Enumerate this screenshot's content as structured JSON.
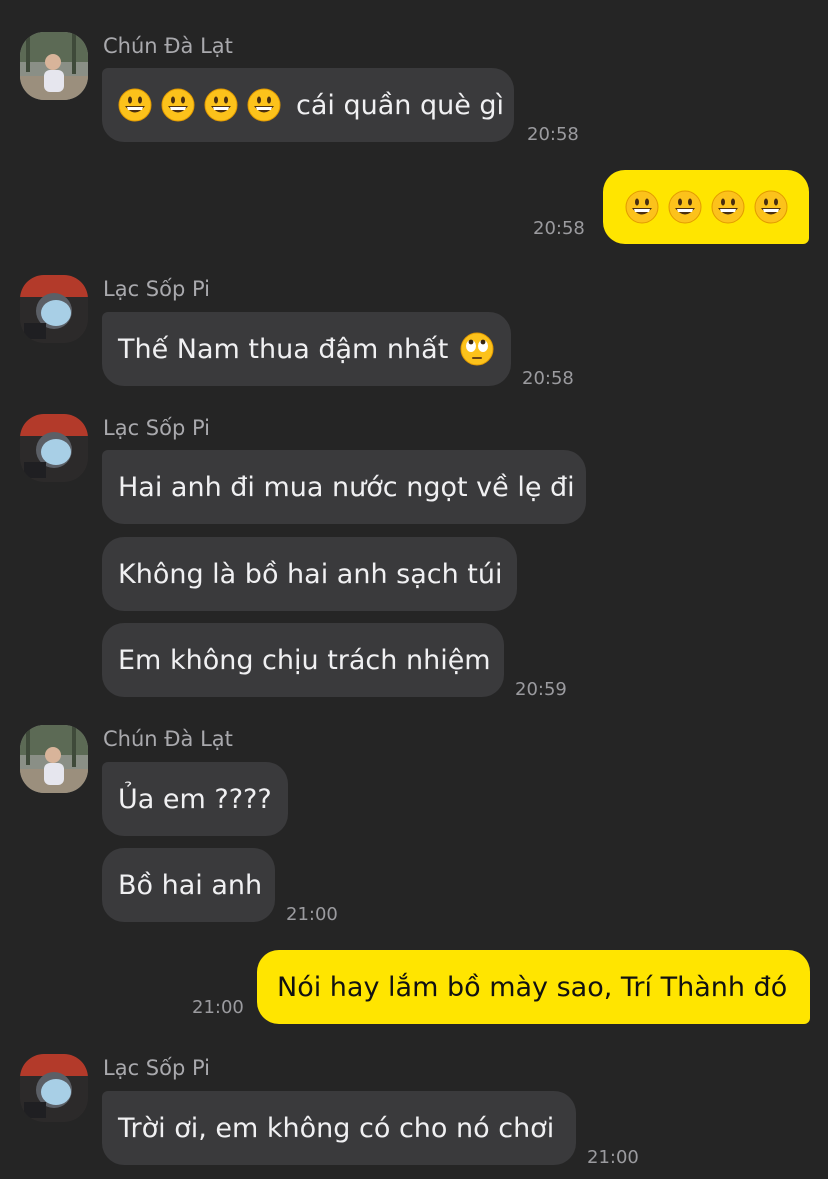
{
  "senders": {
    "chun": "Chún Đà Lạt",
    "lac": "Lạc Sốp Pi"
  },
  "messages": {
    "m1_text": "cái quần què gì",
    "m1_time": "20:58",
    "m2_time": "20:58",
    "m3_text": "Thế Nam thua đậm nhất",
    "m3_time": "20:58",
    "m4_text": "Hai anh đi mua nước ngọt về lẹ đi",
    "m5_text": "Không là bồ hai anh sạch túi",
    "m6_text": "Em không chịu trách nhiệm",
    "m6_time": "20:59",
    "m7_text": "Ủa em ????",
    "m8_text": "Bồ hai anh",
    "m8_time": "21:00",
    "m9_text": "Nói hay lắm bồ mày sao, Trí Thành đó",
    "m9_time": "21:00",
    "m10_text": "Trời ơi, em không có cho nó chơi",
    "m10_time": "21:00"
  },
  "emojis": {
    "smile": "grinning-face-emoji",
    "roll": "rolling-eyes-emoji"
  },
  "colors": {
    "background": "#252525",
    "incoming_bubble": "#3a3a3c",
    "outgoing_bubble": "#ffe500",
    "sender_name": "#a9a9ad",
    "timestamp": "#9b9b9f"
  }
}
